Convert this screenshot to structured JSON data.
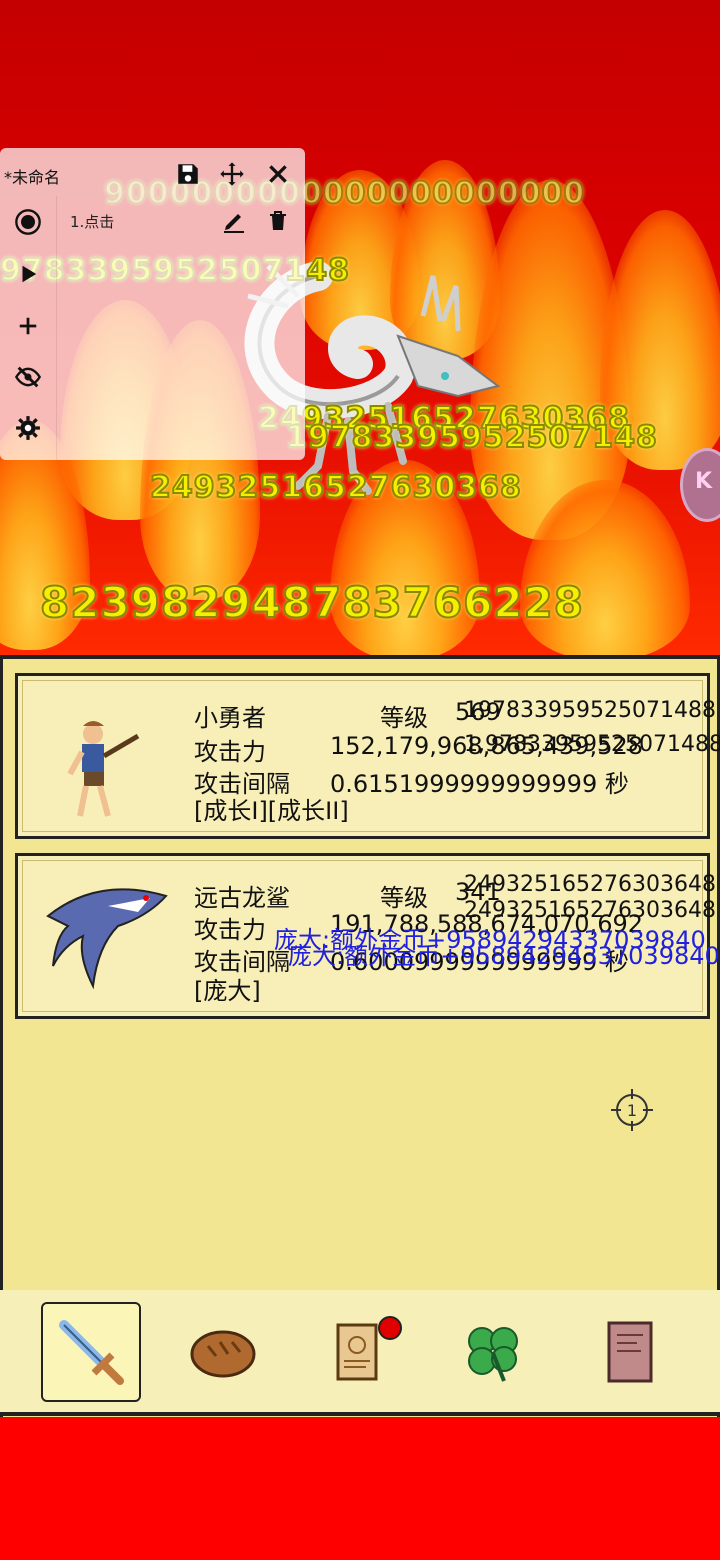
{
  "recorder": {
    "title": "*未命名",
    "item_label": "1.点击"
  },
  "battle": {
    "damage_numbers": {
      "top": "9000000000000000000000",
      "left": "9783395952507148",
      "mid_1": "249325165276303648",
      "mid_2": "19783395952507148",
      "mid_3": "24932516527630368",
      "big": "823982948783766228"
    },
    "side_bubble_text": "K"
  },
  "heroes": [
    {
      "name": "小勇者",
      "level_label": "等级",
      "level": "569",
      "attack_label": "攻击力",
      "attack": "152,179,968,865,439,528",
      "interval_label": "攻击间隔",
      "interval": "0.6151999999999999 秒",
      "tags": "[成长I][成长II]",
      "overlay_1": "19783395952507148​8",
      "overlay_2": "1,9783395952507148​8"
    },
    {
      "name": "远古龙鲨",
      "level_label": "等级",
      "level": "341",
      "attack_label": "攻击力",
      "attack": "191,788,588,674,070,692",
      "interval_label": "攻击间隔",
      "interval": "0.6000999999999999 秒",
      "tags": "[庞大]",
      "overlay_1": "249325165276303648",
      "overlay_2": "249325165276303648",
      "blue_1": "庞大:额外金币+958942943370398​40",
      "blue_2": "庞大:额外金币+958942943370398​40"
    }
  ],
  "target_label": "1",
  "nav": {
    "items": [
      "sword",
      "bread",
      "scroll",
      "clover",
      "book"
    ],
    "active": "sword"
  },
  "colors": {
    "background_red": "#ff0000",
    "panel": "#f2e692",
    "damage_text": "#f6f000",
    "bonus_text": "#2020e0"
  }
}
